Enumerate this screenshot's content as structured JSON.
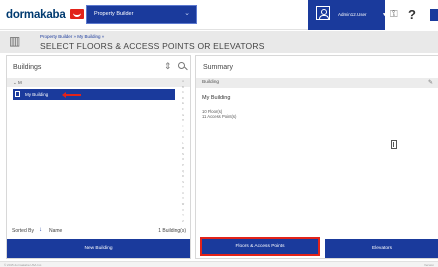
{
  "header": {
    "logo_text": "dormakaba",
    "brand_color": "#1a3a9c",
    "accent_color": "#e2231a",
    "property_selector": {
      "value": "Property Builder"
    },
    "user": {
      "name": "Admin12.User"
    },
    "icons": [
      "key-icon",
      "help-icon"
    ],
    "help_glyph": "?"
  },
  "subheader": {
    "breadcrumb": "Property Builder » My Building »",
    "title": "SELECT FLOORS & ACCESS POINTS OR ELEVATORS"
  },
  "buildings_panel": {
    "title": "Buildings",
    "group_header": "M",
    "items": [
      {
        "label": "My Building",
        "selected": true
      }
    ],
    "alpha_index": [
      "A",
      "B",
      "C",
      "D",
      "E",
      "F",
      "G",
      "H",
      "I",
      "J",
      "K",
      "L",
      "M",
      "N",
      "O",
      "P",
      "Q",
      "R",
      "S",
      "T",
      "U",
      "V",
      "W",
      "X",
      "Y",
      "Z"
    ],
    "sorted_by_label": "Sorted By",
    "sorted_by_value": "Name",
    "count_text": "1 Building(s)",
    "new_button": "New Building"
  },
  "summary_panel": {
    "title": "Summary",
    "section_label": "Building",
    "building_name": "My Building",
    "floors": "10 Floor(s)",
    "access_points": "11 Access Point(s)",
    "floors_button": "Floors & Access Points",
    "elevators_button": "Elevators"
  },
  "status_bar": {
    "left": "© 2015 dormakaba USA Inc.",
    "right": "Version"
  }
}
